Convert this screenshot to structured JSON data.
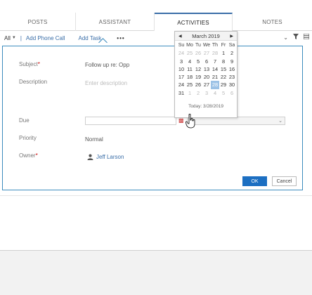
{
  "tabs": [
    {
      "label": "POSTS"
    },
    {
      "label": "ASSISTANT"
    },
    {
      "label": "ACTIVITIES",
      "active": true
    },
    {
      "label": "NOTES"
    }
  ],
  "toolbar": {
    "filter_all": "All",
    "separator": "|",
    "add_phone_call": "Add Phone Call",
    "add_task": "Add Task",
    "more": "•••",
    "icons": [
      "chevron-down-icon",
      "filter-icon",
      "list-icon"
    ]
  },
  "form": {
    "subject_label": "Subject",
    "subject_value": "Follow up re: Opp",
    "description_label": "Description",
    "description_placeholder": "Enter description",
    "due_label": "Due",
    "priority_label": "Priority",
    "priority_value": "Normal",
    "owner_label": "Owner",
    "owner_value": "Jeff Larson",
    "required_mark": "*",
    "ok_label": "OK",
    "cancel_label": "Cancel"
  },
  "calendar": {
    "month_title": "March 2019",
    "dow": [
      "Su",
      "Mo",
      "Tu",
      "We",
      "Th",
      "Fr",
      "Sa"
    ],
    "days": [
      {
        "d": "24",
        "other": true
      },
      {
        "d": "25",
        "other": true
      },
      {
        "d": "26",
        "other": true
      },
      {
        "d": "27",
        "other": true
      },
      {
        "d": "28",
        "other": true
      },
      {
        "d": "1"
      },
      {
        "d": "2"
      },
      {
        "d": "3"
      },
      {
        "d": "4"
      },
      {
        "d": "5"
      },
      {
        "d": "6"
      },
      {
        "d": "7"
      },
      {
        "d": "8"
      },
      {
        "d": "9"
      },
      {
        "d": "10"
      },
      {
        "d": "11"
      },
      {
        "d": "12"
      },
      {
        "d": "13"
      },
      {
        "d": "14"
      },
      {
        "d": "15"
      },
      {
        "d": "16"
      },
      {
        "d": "17"
      },
      {
        "d": "18"
      },
      {
        "d": "19"
      },
      {
        "d": "20"
      },
      {
        "d": "21"
      },
      {
        "d": "22"
      },
      {
        "d": "23"
      },
      {
        "d": "24"
      },
      {
        "d": "25"
      },
      {
        "d": "26"
      },
      {
        "d": "27"
      },
      {
        "d": "28",
        "selected": true
      },
      {
        "d": "29"
      },
      {
        "d": "30"
      },
      {
        "d": "31"
      },
      {
        "d": "1",
        "other": true
      },
      {
        "d": "2",
        "other": true
      },
      {
        "d": "3",
        "other": true
      },
      {
        "d": "4",
        "other": true
      },
      {
        "d": "5",
        "other": true
      },
      {
        "d": "6",
        "other": true
      }
    ],
    "today_label": "Today: 3/28/2019"
  },
  "colors": {
    "accent": "#3a6ea8",
    "panel_border": "#3b8bbd",
    "ok_button": "#1c6fc2",
    "selected_day": "#9cc2e6"
  }
}
